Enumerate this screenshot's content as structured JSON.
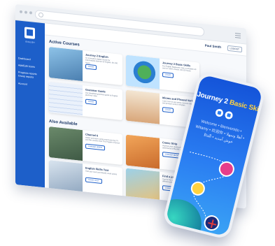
{
  "header": {
    "user_name": "Paul Smith",
    "logout": "LOGOUT"
  },
  "sidebar": {
    "logo_text": "ENGLISH",
    "items": [
      {
        "label": "Dashboard"
      },
      {
        "label": "Add/Edit Users"
      },
      {
        "label": "Progress reports Group reports"
      },
      {
        "label": "Account"
      }
    ]
  },
  "active_courses": {
    "heading": "Active Courses",
    "cards": [
      {
        "title": "Journey 2 English",
        "desc": "An innovative digital course for intermediate learners of English. 60-100 hours.",
        "button": "START"
      },
      {
        "title": "Journey 2 Basic Skills",
        "desc": "For English Beginners: Get a complete A0 and A1 100% course. 80-100 hours",
        "button": "START"
      },
      {
        "title": "Grammar Guide",
        "desc": "Our simplified grammar guide to English grammar rules",
        "button": "START"
      },
      {
        "title": "Idioms and Phrasal Verbs",
        "desc": "Learn how to use some common idioms and phrasal verbs in English",
        "button": "START"
      }
    ]
  },
  "also_available": {
    "heading": "Also Available",
    "cards": [
      {
        "title": "Channel 6",
        "desc": "Watch and learn using award-winning TV and film content from The English Channel",
        "button": "CHANGE VIDEO"
      },
      {
        "title": "Comic Strip",
        "desc": "Improve your reading through fun adventures of Buckle and friends",
        "button": "CHANGE BOOK"
      },
      {
        "title": "English Skills Test",
        "desc": "Test your level and identify weak points",
        "button": "START TEST"
      },
      {
        "title": "Find a job",
        "desc": "Tips for the world of work and a range of different jobs",
        "button": "CHANGE BOOK"
      }
    ]
  },
  "phone": {
    "title_part1": "Journey 2",
    "title_part2": "Basic Skills",
    "welcome_line1": "Welcome • Bienvenido •",
    "welcome_line2": "Witamy • 欢迎你 • أهلا وسهلا •",
    "welcome_line3": "ยินดี • خوش آمدید"
  },
  "colors": {
    "brand": "#1d5fc9",
    "accent": "#ffd23f",
    "heading": "#1f3a68"
  }
}
